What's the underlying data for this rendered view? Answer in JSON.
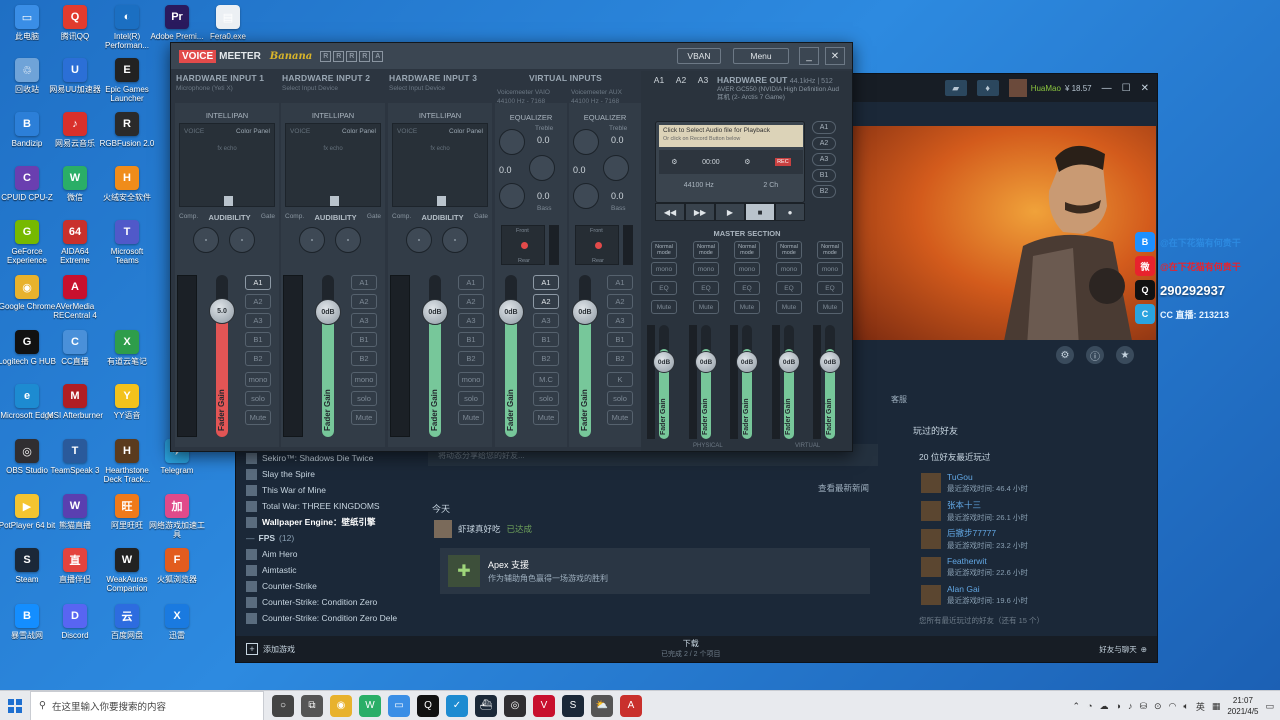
{
  "desktop": {
    "icons": [
      {
        "label": "此电脑",
        "color": "#3a8ee6",
        "glyph": "▭"
      },
      {
        "label": "腾讯QQ",
        "color": "#e23b2e",
        "glyph": "Q"
      },
      {
        "label": "Intel(R) Performan...",
        "color": "#1b6fc2",
        "glyph": "◐"
      },
      {
        "label": "Adobe Premi...",
        "color": "#2a1a5e",
        "glyph": "Pr"
      },
      {
        "label": "Fera0.exe",
        "color": "#ecf0f4",
        "glyph": "▤"
      },
      {
        "label": "回收站",
        "color": "#6fa3d8",
        "glyph": "♲"
      },
      {
        "label": "网易UU加速器",
        "color": "#2b6fd6",
        "glyph": "U"
      },
      {
        "label": "Epic Games Launcher",
        "color": "#222222",
        "glyph": "E"
      },
      {
        "label": "Bandizip",
        "color": "#2c7fd8",
        "glyph": "B"
      },
      {
        "label": "网易云音乐",
        "color": "#d9302b",
        "glyph": "♪"
      },
      {
        "label": "RGBFusion 2.0",
        "color": "#2a2a2a",
        "glyph": "R"
      },
      {
        "label": "CPUID CPU-Z",
        "color": "#6a3fb0",
        "glyph": "C"
      },
      {
        "label": "微信",
        "color": "#2aae67",
        "glyph": "W"
      },
      {
        "label": "火绒安全软件",
        "color": "#f08c1a",
        "glyph": "H"
      },
      {
        "label": "GeForce Experience",
        "color": "#76b900",
        "glyph": "G"
      },
      {
        "label": "AIDA64 Extreme",
        "color": "#c9302c",
        "glyph": "64"
      },
      {
        "label": "Microsoft Teams",
        "color": "#5059c9",
        "glyph": "T"
      },
      {
        "label": "Google Chrome",
        "color": "#e8b22d",
        "glyph": "◉"
      },
      {
        "label": "AVerMedia RECentral 4",
        "color": "#c8102e",
        "glyph": "A"
      },
      {
        "label": "Logitech G HUB",
        "color": "#111111",
        "glyph": "G"
      },
      {
        "label": "CC直播",
        "color": "#4a90d9",
        "glyph": "C"
      },
      {
        "label": "有道云笔记",
        "color": "#2e9d4b",
        "glyph": "X"
      },
      {
        "label": "Microsoft Edge",
        "color": "#1d8bd1",
        "glyph": "e"
      },
      {
        "label": "MSI Afterburner",
        "color": "#b01e23",
        "glyph": "M"
      },
      {
        "label": "YY语音",
        "color": "#f3c21c",
        "glyph": "Y"
      },
      {
        "label": "OBS Studio",
        "color": "#302e31",
        "glyph": "◎"
      },
      {
        "label": "TeamSpeak 3",
        "color": "#2a5a9b",
        "glyph": "T"
      },
      {
        "label": "Hearthstone Deck Track...",
        "color": "#5a3b1e",
        "glyph": "H"
      },
      {
        "label": "Telegram",
        "color": "#2aa3df",
        "glyph": "✈"
      },
      {
        "label": "PotPlayer 64 bit",
        "color": "#f4c430",
        "glyph": "▶"
      },
      {
        "label": "熊猫直播",
        "color": "#5a3fb0",
        "glyph": "W"
      },
      {
        "label": "阿里旺旺",
        "color": "#f07a1a",
        "glyph": "旺"
      },
      {
        "label": "网络游戏加速工具",
        "color": "#e04a8a",
        "glyph": "加"
      },
      {
        "label": "Steam",
        "color": "#1b2838",
        "glyph": "S"
      },
      {
        "label": "直播伴侣",
        "color": "#e4433e",
        "glyph": "直"
      },
      {
        "label": "WeakAuras Companion",
        "color": "#222222",
        "glyph": "W"
      },
      {
        "label": "火狐浏览器",
        "color": "#e25c1e",
        "glyph": "F"
      },
      {
        "label": "暴雪战网",
        "color": "#148eff",
        "glyph": "B"
      },
      {
        "label": "Discord",
        "color": "#5865f2",
        "glyph": "D"
      },
      {
        "label": "百度网盘",
        "color": "#2d6cdf",
        "glyph": "云"
      },
      {
        "label": "迅雷",
        "color": "#1a7ae0",
        "glyph": "X"
      }
    ]
  },
  "voicemeeter": {
    "logo_voice": "VOICE",
    "logo_meeter": "MEETER",
    "logo_banana": "Banana",
    "r_buttons": [
      "R",
      "R",
      "R",
      "R",
      "A"
    ],
    "vban_label": "VBAN",
    "menu_label": "Menu",
    "min_label": "_",
    "close_label": "✕",
    "hw_inputs": [
      {
        "title": "HARDWARE INPUT 1",
        "device": "Microphone (Yeti X)",
        "fader_value": "5.0",
        "fader_color": "#e25555",
        "fader_level": 0.78
      },
      {
        "title": "HARDWARE INPUT 2",
        "device": "Select Input Device",
        "fader_value": "0dB",
        "fader_color": "#77c79a",
        "fader_level": 0.77
      },
      {
        "title": "HARDWARE INPUT 3",
        "device": "Select Input Device",
        "fader_value": "0dB",
        "fader_color": "#77c79a",
        "fader_level": 0.77
      }
    ],
    "intellipan": "INTELLIPAN",
    "voice_lbl": "VOICE",
    "color_panel": "Color Panel",
    "fx_echo": "fx echo",
    "comp": "Comp.",
    "audibility": "AUDIBILITY",
    "gate": "Gate",
    "fader_gain": "Fader Gain",
    "bus_buttons": [
      "A1",
      "A2",
      "A3",
      "B1",
      "B2"
    ],
    "mono": "mono",
    "solo": "solo",
    "mute": "Mute",
    "virtual_inputs_title": "VIRTUAL INPUTS",
    "virtual_inputs": [
      {
        "device": "Voicemeeter VAIO",
        "rate": "44100 Hz - 7168",
        "fader_value": "0dB",
        "mc": "M.C",
        "fader_level": 0.77
      },
      {
        "device": "Voicemeeter AUX",
        "rate": "44100 Hz - 7168",
        "fader_value": "0dB",
        "mc": "K",
        "fader_level": 0.77
      }
    ],
    "equalizer": "EQUALIZER",
    "treble": "Treble",
    "bass": "Bass",
    "eq_val": "0.0",
    "front": "Front",
    "rear": "Rear",
    "hw_out": {
      "a_labels": [
        "A1",
        "A2",
        "A3"
      ],
      "title": "HARDWARE OUT",
      "rate": "44.1kHz | 512",
      "line1": "AVER GC550 (NVIDIA High Definition Aud",
      "line2": "耳机 (2- Arctis 7 Game)"
    },
    "player": {
      "line1": "Click to Select Audio file for Playback",
      "line2": "Or click on Record Button below",
      "time": "00:00",
      "rec": "REC",
      "hz": "44100 Hz",
      "ch": "2 Ch",
      "outs": [
        "A1",
        "A2",
        "A3",
        "B1",
        "B2"
      ],
      "transport": [
        "◀◀",
        "▶▶",
        "▶",
        "■",
        "●"
      ]
    },
    "master_title": "MASTER SECTION",
    "master_cols": [
      {
        "mode": "Normal mode",
        "bus": "A1",
        "value": "0dB"
      },
      {
        "mode": "Normal mode",
        "bus": "A2",
        "value": "0dB"
      },
      {
        "mode": "Normal mode",
        "bus": "A3",
        "value": "0dB"
      },
      {
        "mode": "Normal mode",
        "bus": "B1",
        "value": "0dB"
      },
      {
        "mode": "Normal mode",
        "bus": "B2",
        "value": "0dB"
      }
    ],
    "eq_btn": "EQ",
    "physical": "PHYSICAL",
    "virtual": "VIRTUAL"
  },
  "steam": {
    "user": "HuaMao",
    "balance": "¥ 18.57",
    "review_tab": "客服",
    "games": [
      {
        "name": "Sekiro™: Shadows Die Twice"
      },
      {
        "name": "Slay the Spire"
      },
      {
        "name": "This War of Mine"
      },
      {
        "name": "Total War: THREE KINGDOMS"
      },
      {
        "name": "Wallpaper Engine：壁纸引擎",
        "bold": true
      }
    ],
    "category": "FPS",
    "category_count": "(12)",
    "games2": [
      {
        "name": "Aim Hero"
      },
      {
        "name": "Aimtastic"
      },
      {
        "name": "Counter-Strike"
      },
      {
        "name": "Counter-Strike: Condition Zero"
      },
      {
        "name": "Counter-Strike: Condition Zero Dele"
      }
    ],
    "news_top": "将动态分享给您的好友...",
    "news_more": "查看最新新闻",
    "today": "今天",
    "feed_name": "虾球真好吃",
    "feed_status": "已达成",
    "apex_title": "Apex 支援",
    "apex_sub": "作为辅助角色赢得一场游戏的胜利",
    "friends_title": "玩过的好友",
    "friends_count": "20 位好友最近玩过",
    "friends": [
      {
        "name": "TuGou",
        "time": "最近游戏时间: 46.4 小时"
      },
      {
        "name": "张本十三",
        "time": "最近游戏时间: 26.1 小时"
      },
      {
        "name": "后撤步77777",
        "time": "最近游戏时间: 23.2 小时"
      },
      {
        "name": "Featherwit",
        "time": "最近游戏时间: 22.6 小时"
      },
      {
        "name": "Alan Gai",
        "time": "最近游戏时间: 19.6 小时"
      }
    ],
    "friends_more": "您所有最近玩过的好友（还有 15 个）",
    "add_game": "添加游戏",
    "download": "下载",
    "download_sub": "已完成 2 / 2 个项目",
    "friends_chat": "好友与聊天"
  },
  "social": {
    "rows": [
      {
        "text": "@在下花猫有何贵干",
        "color": "#2d8ae0",
        "icon_bg": "#1e90ff",
        "glyph": "B",
        "big": false
      },
      {
        "text": "@在下花猫有何贵干",
        "color": "#e8232d",
        "icon_bg": "#e8232d",
        "glyph": "微",
        "big": false
      },
      {
        "text": "290292937",
        "color": "#ffffff",
        "icon_bg": "#111111",
        "glyph": "Q",
        "big": true
      },
      {
        "text": "CC 直播: 213213",
        "color": "#e8f4ff",
        "icon_bg": "#2aa3df",
        "glyph": "C",
        "big": false
      }
    ]
  },
  "taskbar": {
    "search_placeholder": "在这里输入你要搜索的内容",
    "apps": [
      {
        "color": "#444444",
        "glyph": "○"
      },
      {
        "color": "#555555",
        "glyph": "⧉"
      },
      {
        "color": "#e8b22d",
        "glyph": "◉"
      },
      {
        "color": "#2aae67",
        "glyph": "W"
      },
      {
        "color": "#3a8ee6",
        "glyph": "▭"
      },
      {
        "color": "#111111",
        "glyph": "Q"
      },
      {
        "color": "#1d8bd1",
        "glyph": "✓"
      },
      {
        "color": "#1b2838",
        "glyph": "⛴"
      },
      {
        "color": "#302e31",
        "glyph": "◎"
      },
      {
        "color": "#c8102e",
        "glyph": "V"
      },
      {
        "color": "#1b2838",
        "glyph": "S"
      },
      {
        "color": "#555555",
        "glyph": "⛅"
      },
      {
        "color": "#c9302c",
        "glyph": "A"
      }
    ],
    "ime": "英",
    "time": "21:07",
    "date": "2021/4/5"
  }
}
